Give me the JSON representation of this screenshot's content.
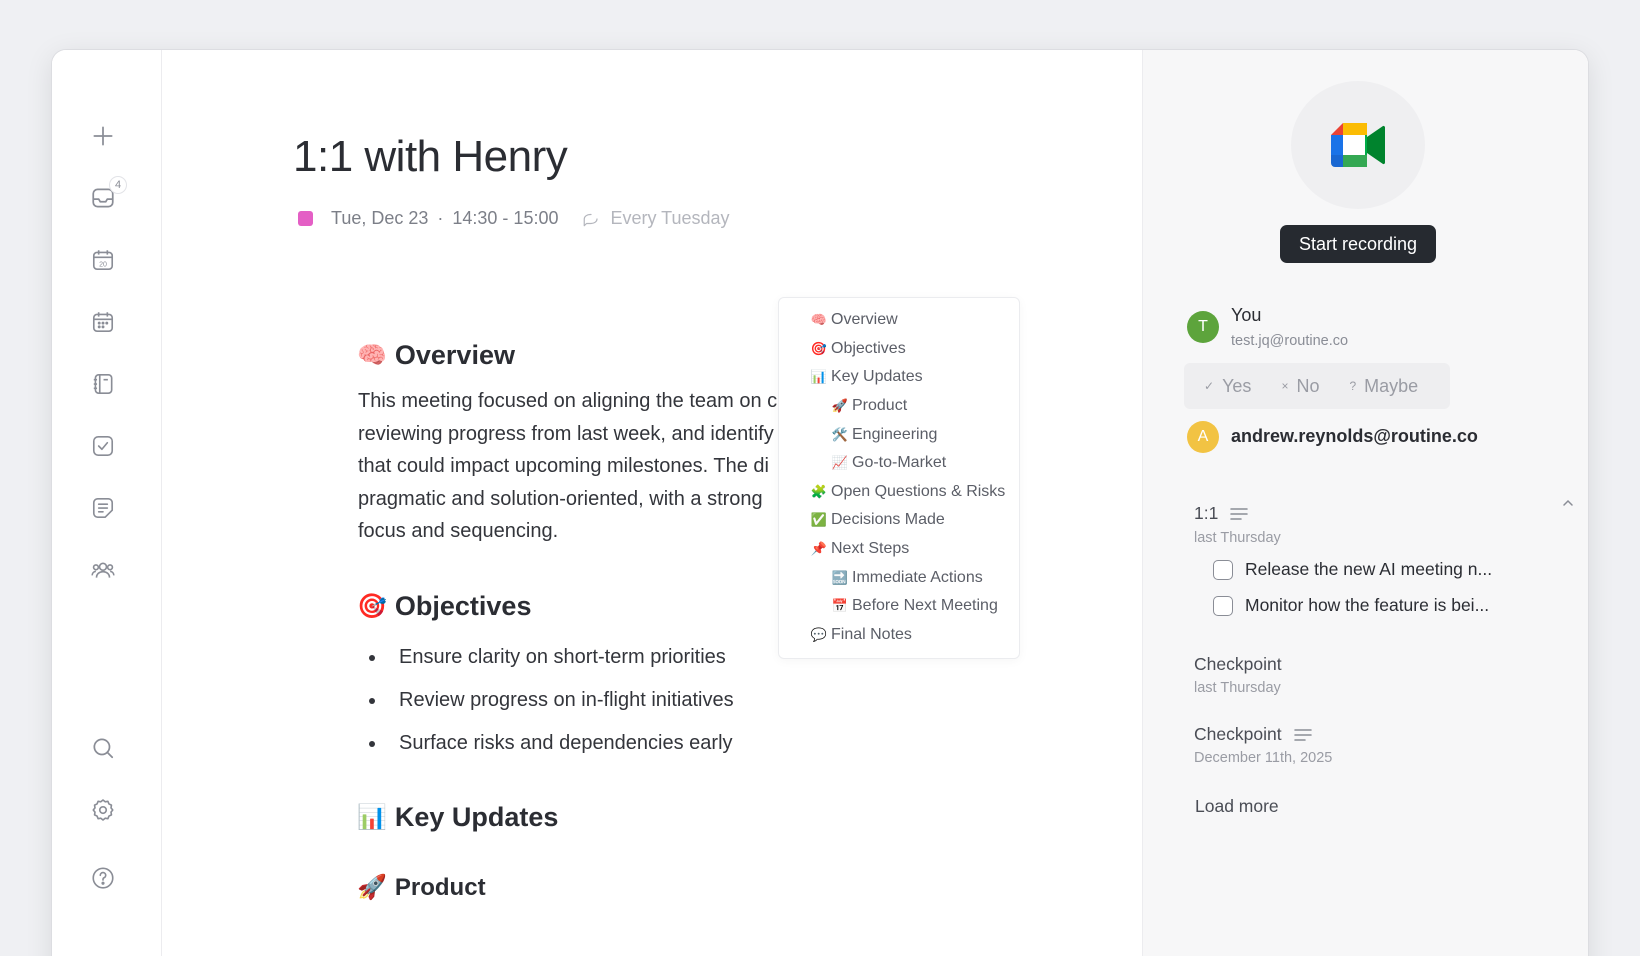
{
  "window": {
    "controls": [
      "close",
      "minimize",
      "zoom"
    ]
  },
  "sidebar": {
    "icons": [
      "plus-icon",
      "inbox-icon",
      "calendar-day-icon",
      "calendar-icon",
      "notebook-icon",
      "tasks-icon",
      "notes-icon",
      "people-icon",
      "search-icon",
      "settings-icon",
      "help-icon"
    ],
    "inbox_count": "4",
    "calendar_day": "20"
  },
  "event": {
    "title": "1:1 with Henry",
    "date": "Tue, Dec 23",
    "separator": "·",
    "time": "14:30 - 15:00",
    "recurrence": "Every Tuesday",
    "calendar_color": "#e45fc5"
  },
  "content": {
    "overview": {
      "emoji": "🧠",
      "heading": "Overview"
    },
    "paragraph_lines": [
      "This meeting focused on aligning the team on c",
      "reviewing progress from last week, and identify",
      "that could impact upcoming milestones. The di",
      "pragmatic and solution-oriented, with a strong",
      "focus and sequencing."
    ],
    "objectives": {
      "emoji": "🎯",
      "heading": "Objectives",
      "items": [
        "Ensure clarity on short-term priorities",
        "Review progress on in-flight initiatives",
        "Surface risks and dependencies early"
      ]
    },
    "key_updates": {
      "emoji": "📊",
      "heading": "Key Updates"
    },
    "product": {
      "emoji": "🚀",
      "heading": "Product"
    }
  },
  "toc": [
    {
      "emoji": "🧠",
      "label": "Overview",
      "level": 0
    },
    {
      "emoji": "🎯",
      "label": "Objectives",
      "level": 0
    },
    {
      "emoji": "📊",
      "label": "Key Updates",
      "level": 0
    },
    {
      "emoji": "🚀",
      "label": "Product",
      "level": 1
    },
    {
      "emoji": "🛠️",
      "label": "Engineering",
      "level": 1
    },
    {
      "emoji": "📈",
      "label": "Go-to-Market",
      "level": 1
    },
    {
      "emoji": "🧩",
      "label": "Open Questions & Risks",
      "level": 0
    },
    {
      "emoji": "✅",
      "label": "Decisions Made",
      "level": 0
    },
    {
      "emoji": "📌",
      "label": "Next Steps",
      "level": 0
    },
    {
      "emoji": "🔜",
      "label": "Immediate Actions",
      "level": 1
    },
    {
      "emoji": "📅",
      "label": "Before Next Meeting",
      "level": 1
    },
    {
      "emoji": "💬",
      "label": "Final Notes",
      "level": 0
    }
  ],
  "panel": {
    "record_button": "Start recording",
    "you": {
      "initial": "T",
      "name": "You",
      "email": "test.jq@routine.co",
      "color": "#5da43c"
    },
    "rsvp": [
      {
        "glyph": "✓",
        "label": "Yes"
      },
      {
        "glyph": "×",
        "label": "No"
      },
      {
        "glyph": "?",
        "label": "Maybe"
      }
    ],
    "attendee": {
      "initial": "A",
      "email": "andrew.reynolds@routine.co",
      "color": "#f2c343"
    },
    "notes": [
      {
        "title": "1:1",
        "date": "last Thursday",
        "has_doc_icon": true,
        "tasks": [
          "Release the new AI meeting n...",
          "Monitor how the feature is bei..."
        ]
      },
      {
        "title": "Checkpoint",
        "date": "last Thursday",
        "has_doc_icon": false
      },
      {
        "title": "Checkpoint",
        "date": "December 11th, 2025",
        "has_doc_icon": true
      }
    ],
    "load_more": "Load more"
  }
}
